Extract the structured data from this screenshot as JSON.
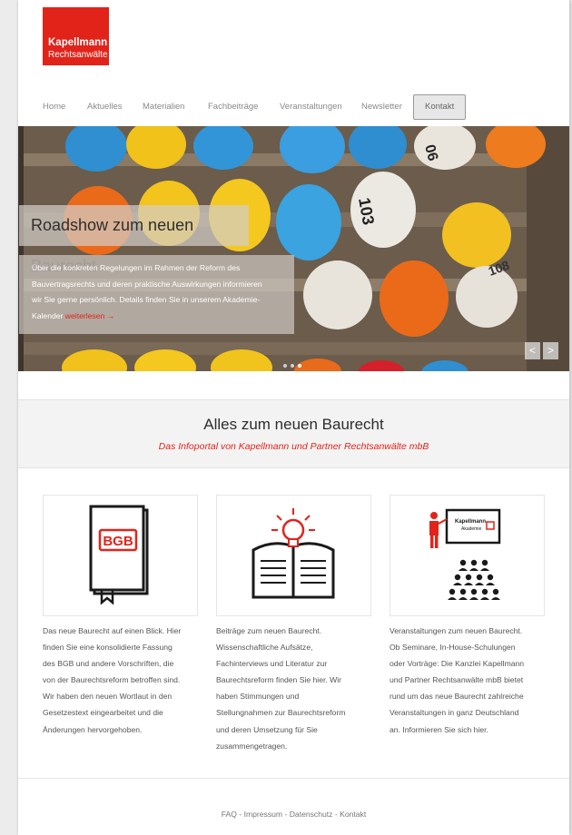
{
  "logo": {
    "line1": "Kapellmann",
    "line2": "Rechtsanwälte"
  },
  "nav": {
    "items": [
      "Home",
      "Aktuelles",
      "Materialien",
      "Fachbeiträge",
      "Veranstaltungen",
      "Newsletter",
      "Kontakt"
    ],
    "active": "Kontakt"
  },
  "hero": {
    "title": "Roadshow zum neuen Baurecht",
    "text_lines": [
      "Über die konkreten Regelungen im Rahmen der Reform des",
      "Bauvertragsrechts und deren praktische Auswirkungen informieren",
      "wir Sie gerne persönlich. Details finden Sie in unserem Akademie-"
    ],
    "text_last": "Kalender ",
    "read_more": "weiterlesen →",
    "helmet_labels": [
      "06",
      "103",
      "108"
    ],
    "prev": "<",
    "next": ">"
  },
  "band": {
    "title": "Alles zum neuen Baurecht",
    "subtitle": "Das Infoportal von Kapellmann und Partner Rechtsanwälte mbB"
  },
  "cards": [
    {
      "icon": "book-bgb-icon",
      "badge": "BGB",
      "lines": [
        "Das neue Baurecht auf einen Blick. Hier",
        "finden Sie eine konsolidierte Fassung",
        "des BGB und andere Vorschriften, die",
        "von der Baurechtsreform betroffen sind.",
        "Wir haben den neuen Wortlaut in den",
        "Gesetzestext eingearbeitet und die",
        "Änderungen hervorgehoben."
      ]
    },
    {
      "icon": "open-book-lightbulb-icon",
      "lines": [
        "Beiträge zum neuen Baurecht.",
        "Wissenschaftliche Aufsätze,",
        "Fachinterviews und Literatur zur",
        "Baurechtsreform finden Sie hier. Wir",
        "haben Stimmungen und",
        "Stellungnahmen zur Baurechtsreform",
        "und deren Umsetzung für Sie",
        "zusammengetragen."
      ]
    },
    {
      "icon": "presentation-audience-icon",
      "board_line1": "Kapellmann",
      "board_line2": "Akademie",
      "lines": [
        "Veranstaltungen zum neuen Baurecht.",
        "Ob Seminare, In-House-Schulungen",
        "oder Vorträge: Die Kanzlei Kapellmann",
        "und Partner Rechtsanwälte mbB bietet",
        "rund um das neue Baurecht zahlreiche",
        "Veranstaltungen in ganz Deutschland",
        "an. Informieren Sie sich hier."
      ]
    }
  ],
  "footer": {
    "links": [
      "FAQ",
      "Impressum",
      "Datenschutz",
      "Kontakt"
    ],
    "separator": " - "
  },
  "colors": {
    "accent": "#e2231a",
    "band_bg": "#f3f3f3",
    "nav_text": "#8a8a8a"
  }
}
